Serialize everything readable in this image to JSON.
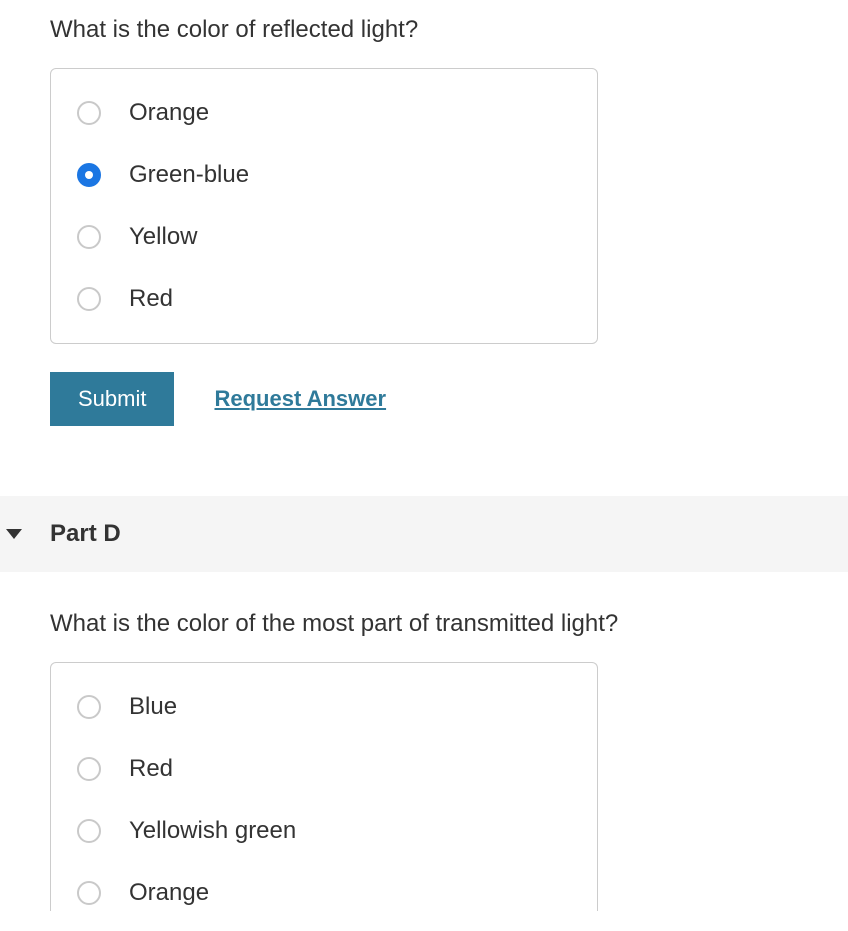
{
  "q1": {
    "question": "What is the color of reflected light?",
    "options": [
      "Orange",
      "Green-blue",
      "Yellow",
      "Red"
    ],
    "selected_index": 1,
    "submit_label": "Submit",
    "request_label": "Request Answer"
  },
  "partD": {
    "title": "Part D",
    "question": "What is the color of the most part of transmitted light?",
    "options": [
      "Blue",
      "Red",
      "Yellowish green",
      "Orange"
    ],
    "selected_index": -1
  }
}
